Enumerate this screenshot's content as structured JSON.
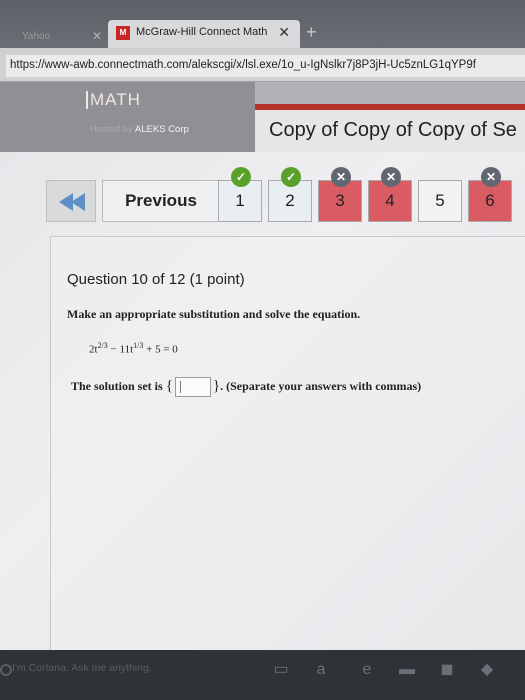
{
  "browser": {
    "inactive_tab_label": "Yahoo",
    "active_tab_label": "McGraw-Hill Connect Math",
    "active_tab_favicon": "M",
    "url": "https://www-awb.connectmath.com/alekscgi/x/lsl.exe/1o_u-IgNslkr7j8P3jH-Uc5znLG1qYP9f"
  },
  "header": {
    "logo": "MATH",
    "hosted_by": "Hosted by",
    "hosted_company": "ALEKS Corp",
    "course_title": "Copy of Copy of Copy of Se",
    "accent_color": "#b5322a"
  },
  "nav": {
    "previous_label": "Previous",
    "questions": [
      {
        "number": "1",
        "status": "correct"
      },
      {
        "number": "2",
        "status": "correct"
      },
      {
        "number": "3",
        "status": "incorrect"
      },
      {
        "number": "4",
        "status": "incorrect"
      },
      {
        "number": "5",
        "status": "unanswered"
      },
      {
        "number": "6",
        "status": "incorrect"
      }
    ]
  },
  "question": {
    "title": "Question 10 of 12 (1 point)",
    "instruction": "Make an appropriate substitution and solve the equation.",
    "equation": {
      "coef1": "2t",
      "exp1": "2/3",
      "middle": " − 11t",
      "exp2": "1/3",
      "tail": " + 5 = 0"
    },
    "solution_prefix": "The solution set is",
    "brace_open": "{",
    "brace_close": "}",
    "answer_value": "",
    "solution_suffix": ". (Separate your answers with commas)"
  },
  "taskbar": {
    "search_placeholder": "I'm Cortana. Ask me anything.",
    "icons": [
      "task-view-icon",
      "amazon-icon",
      "edge-icon",
      "file-explorer-icon",
      "store-icon",
      "dropbox-icon"
    ]
  }
}
